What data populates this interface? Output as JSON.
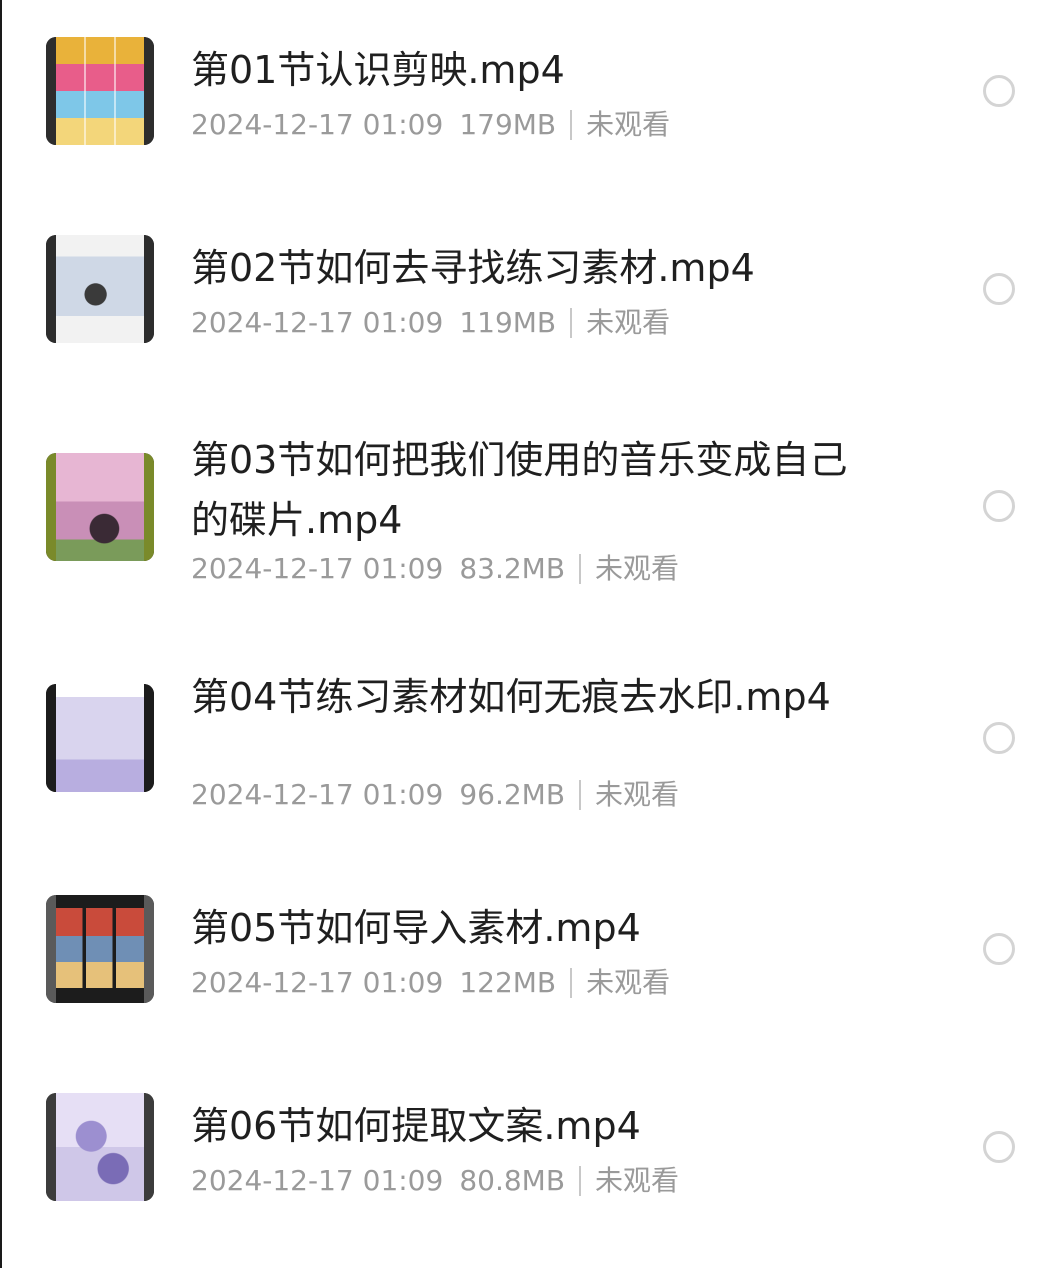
{
  "videos": [
    {
      "title": "第01节认识剪映.mp4",
      "date": "2024-12-17 01:09",
      "size": "179MB",
      "status": "未观看",
      "thumbnail": "photo-grid-thumbnail",
      "colors": [
        "#e9b23a",
        "#e85d8a",
        "#7ec7e8",
        "#f3d67a"
      ]
    },
    {
      "title": "第02节如何去寻找练习素材.mp4",
      "date": "2024-12-17 01:09",
      "size": "119MB",
      "status": "未观看",
      "thumbnail": "social-post-thumbnail",
      "colors": [
        "#f2f2f2",
        "#cfd8e6",
        "#3a3a3a",
        "#9bb7d6"
      ]
    },
    {
      "title": "第03节如何把我们使用的音乐变成自己的碟片.mp4",
      "date": "2024-12-17 01:09",
      "size": "83.2MB",
      "status": "未观看",
      "thumbnail": "cherry-blossom-thumbnail",
      "colors": [
        "#c98fb7",
        "#e7b6d3",
        "#5a3e4f",
        "#7a9b5a"
      ]
    },
    {
      "title": "第04节练习素材如何无痕去水印.mp4",
      "date": "2024-12-17 01:09",
      "size": "96.2MB",
      "status": "未观看",
      "thumbnail": "app-screen-thumbnail",
      "colors": [
        "#d9d4ee",
        "#b8aee0",
        "#8e7fcf",
        "#ffffff"
      ]
    },
    {
      "title": "第05节如何导入素材.mp4",
      "date": "2024-12-17 01:09",
      "size": "122MB",
      "status": "未观看",
      "thumbnail": "media-import-thumbnail",
      "colors": [
        "#1c1c1c",
        "#c94b3b",
        "#e6c17a",
        "#6f8fb5"
      ]
    },
    {
      "title": "第06节如何提取文案.mp4",
      "date": "2024-12-17 01:09",
      "size": "80.8MB",
      "status": "未观看",
      "thumbnail": "anime-art-thumbnail",
      "colors": [
        "#cfc7e8",
        "#9c8fd0",
        "#e6dff5",
        "#7a6cb6"
      ]
    }
  ]
}
